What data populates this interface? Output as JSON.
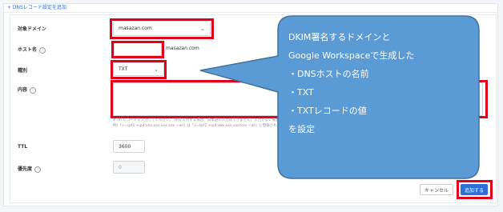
{
  "section": {
    "title": "+ DNSレコード設定を追加"
  },
  "form": {
    "domain_label": "対象ドメイン",
    "domain_value": "masazan.com",
    "host_label": "ホスト名",
    "host_value": "",
    "host_suffix": "masazan.com",
    "type_label": "種別",
    "type_value": "TXT",
    "content_label": "内容",
    "content_value": "",
    "content_hint_line1": "※TXTレコードを入力してください。（例を入力する場合、日本語の入力はできません）入力がない場合は、自動的にシングルクォートが",
    "content_hint_line2": "例）「v=spf1 +ip4:xxx.xxx.xxx.xxx ~all」は「v=spf1 +ip4:xxx.xxx.xxx.xxx ~all」と登録されます。",
    "ttl_label": "TTL",
    "ttl_value": "3600",
    "priority_label": "優先度",
    "priority_value": "0"
  },
  "buttons": {
    "cancel": "キャンセル",
    "add": "追加する"
  },
  "callout": {
    "lines": [
      "DKIM署名するドメインと",
      "Google Workspaceで生成した",
      "・DNSホストの名前",
      "・TXT",
      "・TXTレコードの値",
      "を設定"
    ]
  }
}
